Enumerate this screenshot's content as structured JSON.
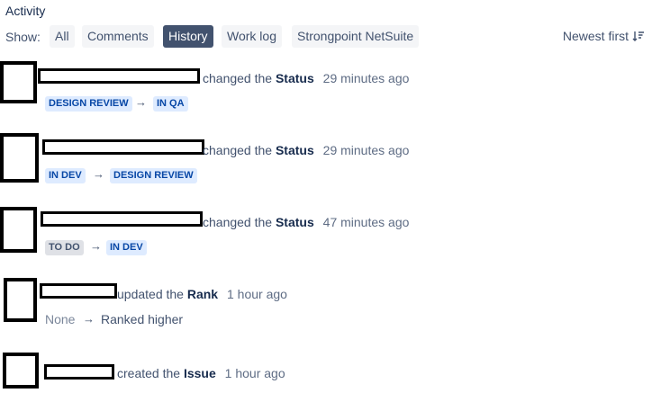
{
  "activity_title": "Activity",
  "show_label": "Show:",
  "filters": [
    {
      "label": "All",
      "active": false
    },
    {
      "label": "Comments",
      "active": false
    },
    {
      "label": "History",
      "active": true
    },
    {
      "label": "Work log",
      "active": false
    },
    {
      "label": "Strongpoint NetSuite",
      "active": false
    }
  ],
  "sort_label": "Newest first",
  "entries": [
    {
      "action": "changed the",
      "field": "Status",
      "time": "29 minutes ago",
      "from": "DESIGN REVIEW",
      "to": "IN QA"
    },
    {
      "action": "changed the",
      "field": "Status",
      "time": "29 minutes ago",
      "from": "IN DEV",
      "to": "DESIGN REVIEW"
    },
    {
      "action": "changed the",
      "field": "Status",
      "time": "47 minutes ago",
      "from": "TO DO",
      "to": "IN DEV"
    },
    {
      "action": "updated the",
      "field": "Rank",
      "time": "1 hour ago",
      "from": "None",
      "to": "Ranked higher"
    },
    {
      "action": "created the",
      "field": "Issue",
      "time": "1 hour ago"
    }
  ],
  "arrow_glyph": "→",
  "colors": {
    "lozenge_blue_bg": "#deebff",
    "lozenge_blue_text": "#0747a6",
    "lozenge_grey_bg": "#dfe1e6",
    "active_filter_bg": "#42526e"
  }
}
